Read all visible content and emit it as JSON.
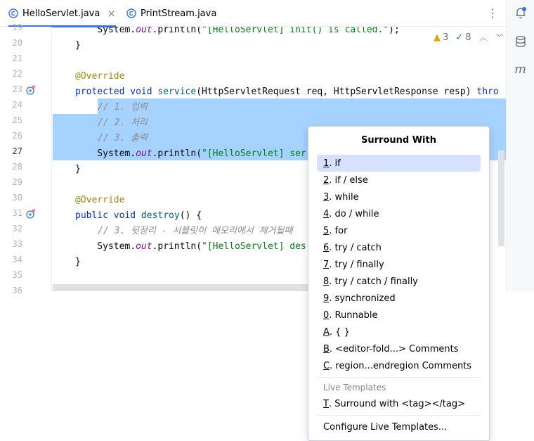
{
  "tabs": [
    {
      "label": "HelloServlet.java",
      "active": true,
      "close": "×"
    },
    {
      "label": "PrintStream.java",
      "active": false
    }
  ],
  "toolbar": {
    "more_label": "⋮"
  },
  "inspections": {
    "warnings": "3",
    "weak_warnings": "8"
  },
  "gutter": {
    "lines": [
      "19",
      "20",
      "21",
      "22",
      "23",
      "24",
      "25",
      "26",
      "27",
      "28",
      "29",
      "30",
      "31",
      "32",
      "33",
      "34",
      "35",
      "36"
    ],
    "current_line": "27"
  },
  "code": {
    "l19_a": "    System.",
    "l19_b": "out",
    "l19_c": ".println(",
    "l19_d": "\"[HelloServlet] init() is called.\"",
    "l19_e": ");",
    "l20": "}",
    "l22": "@Override",
    "l23_kw": "protected void ",
    "l23_fn": "service",
    "l23_rest": "(HttpServletRequest req, HttpServletResponse resp) ",
    "l23_kw2": "thro",
    "l24": "// 1. 입력",
    "l25": "// 2. 처리",
    "l26": "// 3. 출력",
    "l27_a": "    System.",
    "l27_b": "out",
    "l27_c": ".println(",
    "l27_d": "\"[HelloServlet] ser",
    "l28": "}",
    "l30": "@Override",
    "l31_kw": "public void ",
    "l31_fn": "destroy",
    "l31_rest": "() {",
    "l32": "// 3. 뒷정리 - 서블릿이 메모리에서 제거될때",
    "l33_a": "    System.",
    "l33_b": "out",
    "l33_c": ".println(",
    "l33_d": "\"[HelloServlet] des",
    "l34": "}"
  },
  "popup": {
    "title": "Surround With",
    "items": [
      {
        "key": "1",
        "text": ". if"
      },
      {
        "key": "2",
        "text": ". if / else"
      },
      {
        "key": "3",
        "text": ". while"
      },
      {
        "key": "4",
        "text": ". do / while"
      },
      {
        "key": "5",
        "text": ". for"
      },
      {
        "key": "6",
        "text": ". try / catch"
      },
      {
        "key": "7",
        "text": ". try / finally"
      },
      {
        "key": "8",
        "text": ". try / catch / finally"
      },
      {
        "key": "9",
        "text": ". synchronized"
      },
      {
        "key": "0",
        "text": ". Runnable"
      },
      {
        "key": "A",
        "text": ". { }"
      },
      {
        "key": "B",
        "text": ". <editor-fold...> Comments"
      },
      {
        "key": "C",
        "text": ". region...endregion Comments"
      }
    ],
    "group_label": "Live Templates",
    "template_item": {
      "key": "T",
      "text": ". Surround with <tag></tag>"
    },
    "configure_label": "Configure Live Templates..."
  },
  "colors": {
    "accent": "#3574f0",
    "selection": "#a6d2ff",
    "popup_selected": "#d5e1ff"
  }
}
